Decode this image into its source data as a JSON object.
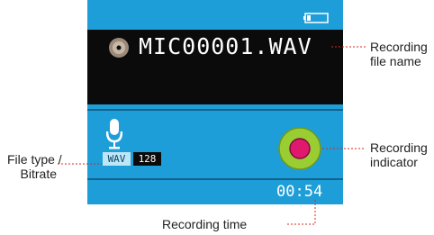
{
  "screen": {
    "file_name": "MIC00001.WAV",
    "file_type": "WAV",
    "bitrate": "128",
    "recording_time": "00:54"
  },
  "callouts": {
    "recording_file_name_line1": "Recording",
    "recording_file_name_line2": "file name",
    "recording_indicator_line1": "Recording",
    "recording_indicator_line2": "indicator",
    "file_type_line1": "File type /",
    "file_type_line2": "Bitrate",
    "recording_time": "Recording time"
  },
  "colors": {
    "screen_background": "#1e9ed8",
    "file_bar_background": "#0b0b0b",
    "indicator_outer": "#9acd32",
    "indicator_inner": "#e0196e",
    "leader_line": "#d9291c"
  },
  "icons": {
    "disc": "disc-icon",
    "battery": "battery-icon",
    "microphone": "microphone-icon"
  }
}
